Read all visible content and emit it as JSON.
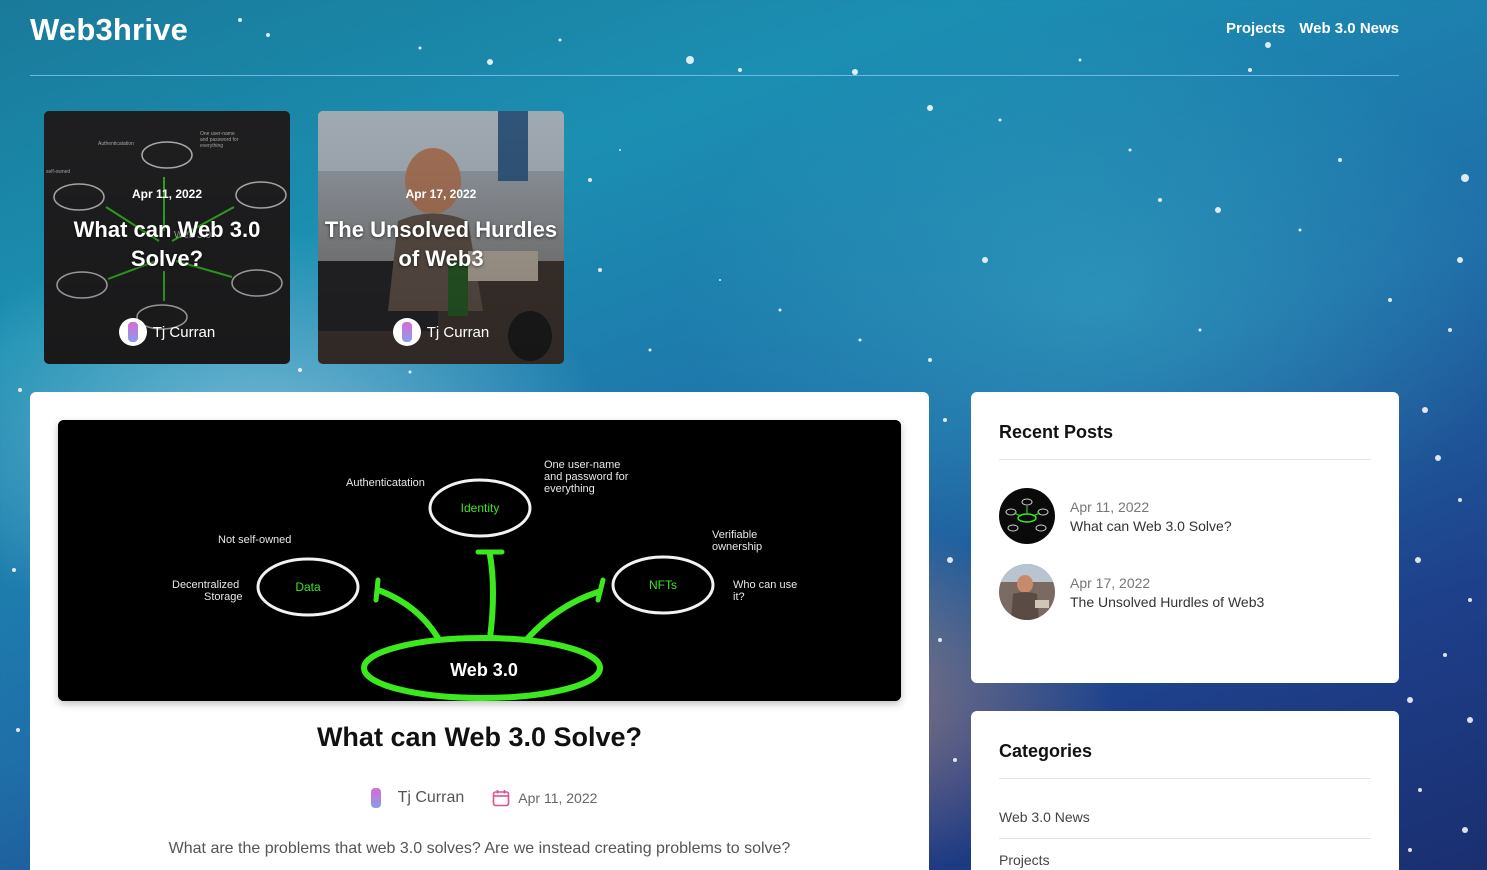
{
  "site": {
    "logo": "Web3hrive"
  },
  "nav": [
    {
      "label": "Projects"
    },
    {
      "label": "Web 3.0 News"
    }
  ],
  "featured": [
    {
      "date": "Apr 11, 2022",
      "title": "What can Web 3.0 Solve?",
      "author": "Tj Curran"
    },
    {
      "date": "Apr 17, 2022",
      "title": "The Unsolved Hurdles of Web3",
      "author": "Tj Curran"
    }
  ],
  "post": {
    "title": "What can Web 3.0 Solve?",
    "author": "Tj Curran",
    "date": "Apr 11, 2022",
    "excerpt": "What are the problems that web 3.0 solves? Are we instead creating problems to solve?",
    "diagram": {
      "center": "Web 3.0",
      "identity": "Identity",
      "data": "Data",
      "nfts": "NFTs",
      "authentication": "Authenticatation",
      "one_user": [
        "One user-name",
        "and password for",
        "everything"
      ],
      "not_self_owned": "Not self-owned",
      "decentralized": [
        "Decentralized",
        "Storage"
      ],
      "verifiable": [
        "Verifiable",
        "ownership"
      ],
      "who_can_use": [
        "Who can use",
        "it?"
      ]
    }
  },
  "recent_posts": {
    "heading": "Recent Posts",
    "items": [
      {
        "date": "Apr 11, 2022",
        "title": "What can Web 3.0 Solve?"
      },
      {
        "date": "Apr 17, 2022",
        "title": "The Unsolved Hurdles of Web3"
      }
    ]
  },
  "categories": {
    "heading": "Categories",
    "items": [
      {
        "label": "Web 3.0 News"
      },
      {
        "label": "Projects"
      }
    ]
  },
  "colors": {
    "accent_green": "#39e01c",
    "calendar_pink": "#e0508f"
  }
}
